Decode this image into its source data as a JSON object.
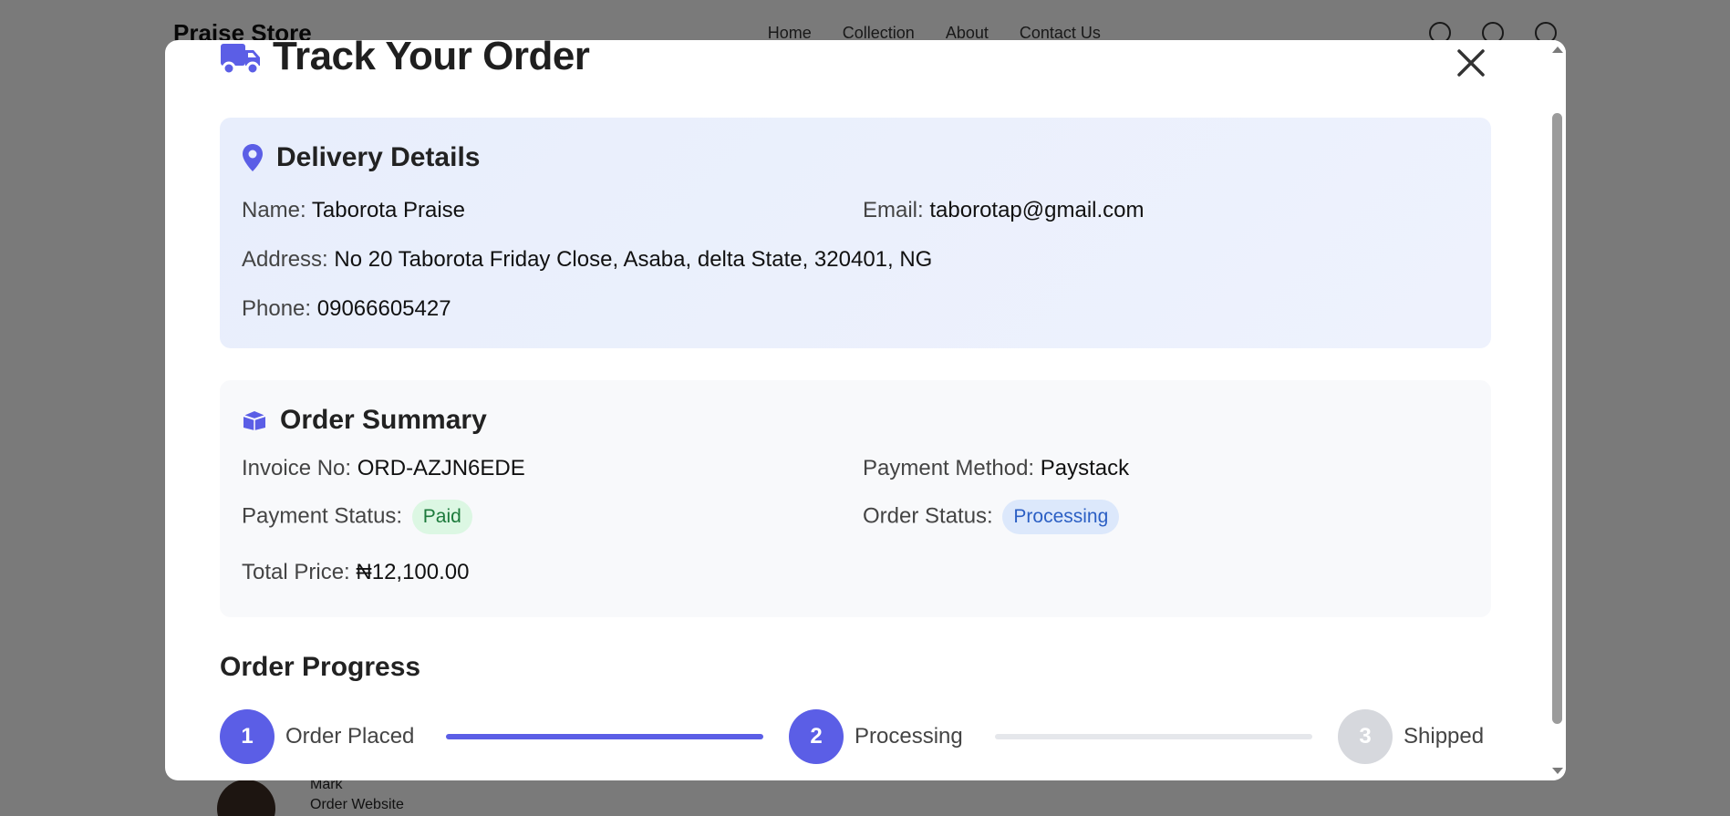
{
  "background": {
    "brand": "Praise Store",
    "nav_links": [
      "Home",
      "Collection",
      "About",
      "Contact Us"
    ],
    "user_name": "Mark",
    "user_sub": "Order Website"
  },
  "modal": {
    "title": "Track Your Order",
    "close_label": "×",
    "delivery": {
      "heading": "Delivery Details",
      "name_label": "Name:",
      "name_value": "Taborota Praise",
      "email_label": "Email:",
      "email_value": "taborotap@gmail.com",
      "address_label": "Address:",
      "address_value": "No 20 Taborota Friday Close, Asaba, delta State, 320401, NG",
      "phone_label": "Phone:",
      "phone_value": "09066605427"
    },
    "summary": {
      "heading": "Order Summary",
      "invoice_label": "Invoice No:",
      "invoice_value": "ORD-AZJN6EDE",
      "payment_method_label": "Payment Method:",
      "payment_method_value": "Paystack",
      "payment_status_label": "Payment Status:",
      "payment_status_value": "Paid",
      "order_status_label": "Order Status:",
      "order_status_value": "Processing",
      "total_label": "Total Price:",
      "total_value": "₦12,100.00"
    },
    "progress": {
      "heading": "Order Progress",
      "steps": [
        {
          "number": "1",
          "label": "Order Placed",
          "state": "done"
        },
        {
          "number": "2",
          "label": "Processing",
          "state": "done"
        },
        {
          "number": "3",
          "label": "Shipped",
          "state": "pending"
        }
      ]
    }
  },
  "colors": {
    "accent": "#5b5ee6",
    "paid_bg": "#dcf7e3",
    "paid_text": "#1c7a3b",
    "processing_bg": "#dce8fb",
    "processing_text": "#2b5fc4",
    "pending_step": "#d6d8dd"
  },
  "icons": {
    "title": "truck-icon",
    "delivery": "map-pin-icon",
    "summary": "box-icon",
    "close": "close-icon"
  }
}
